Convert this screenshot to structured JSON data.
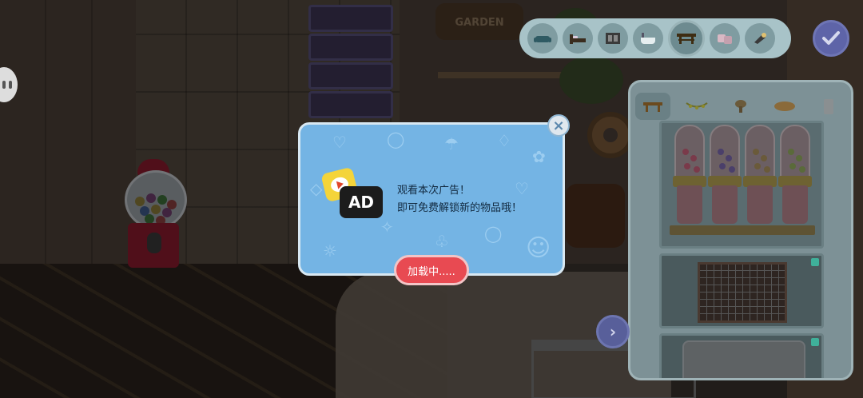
{
  "scene": {
    "garden_sign": "GARDEN",
    "ad_icon_text": "AD"
  },
  "toolbar": {
    "categories": [
      {
        "icon": "sofa-icon"
      },
      {
        "icon": "bed-icon"
      },
      {
        "icon": "cabinet-icon"
      },
      {
        "icon": "bathtub-icon"
      },
      {
        "icon": "table-icon",
        "active": true
      },
      {
        "icon": "decor-icon"
      },
      {
        "icon": "lamp-icon"
      }
    ],
    "confirm_icon": "checkmark-icon"
  },
  "panel": {
    "tabs": [
      {
        "icon": "bench-icon",
        "active": true
      },
      {
        "icon": "garland-icon"
      },
      {
        "icon": "mushroom-lamp-icon"
      },
      {
        "icon": "bread-icon"
      },
      {
        "icon": "jar-icon"
      }
    ],
    "items": [
      {
        "name": "gumball-dispensers"
      },
      {
        "name": "grid-frame"
      },
      {
        "name": "rug"
      }
    ]
  },
  "popup": {
    "message_line1": "观看本次广告！",
    "message_line2": "即可免费解锁新的物品哦！",
    "loading_label": "加载中.....",
    "close_icon": "close-icon"
  },
  "colors": {
    "popup_bg": "#74b4e4",
    "loading_button": "#e84a52",
    "toolbar_bg": "#a8c3c8",
    "confirm_button": "#5e64a8"
  }
}
